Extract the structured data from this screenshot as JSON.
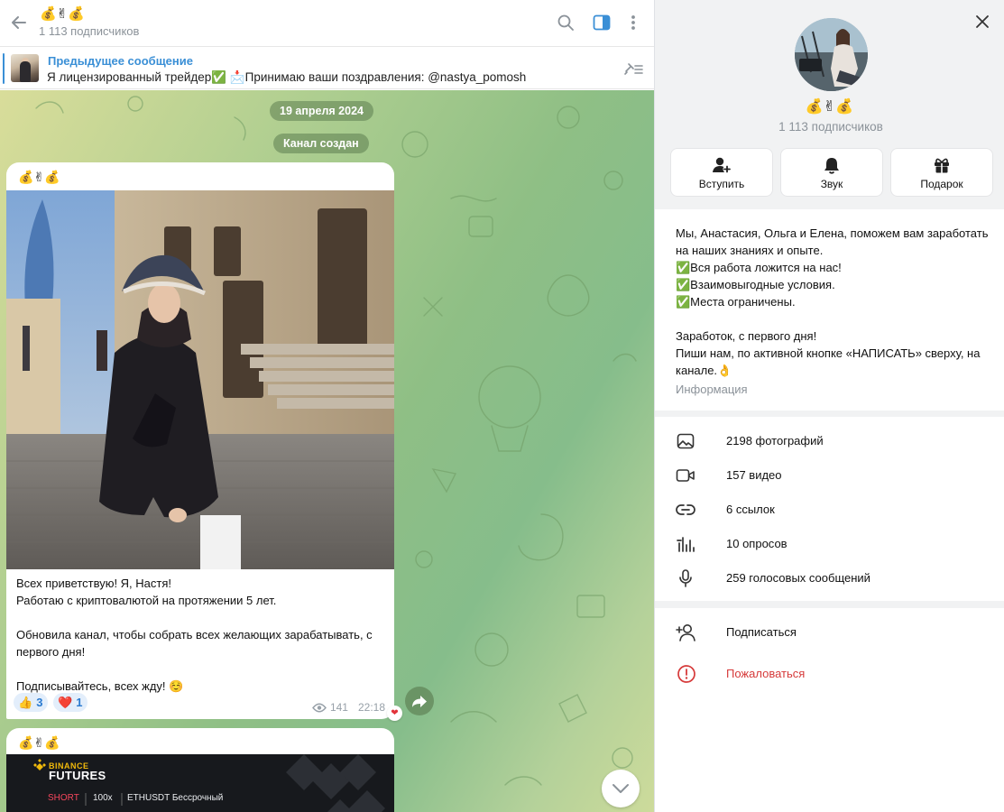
{
  "channel": {
    "title": "💰✌💰",
    "subscribers": "1 113 подписчиков"
  },
  "pinned": {
    "label": "Предыдущее сообщение",
    "text": "Я лицензированный трейдер✅  📩Принимаю ваши поздравления: @nastya_pomosh"
  },
  "chat": {
    "date_pill": "19 апреля 2024",
    "service_pill": "Канал создан",
    "messages": [
      {
        "author": "💰✌💰",
        "lines": [
          "Всех приветствую! Я, Настя!",
          "Работаю с криптовалютой на протяжении 5 лет.",
          "",
          "Обновила канал, чтобы собрать всех желающих зарабатывать, с первого дня!",
          "",
          "Подписывайтесь, всех жду! ☺️"
        ],
        "reactions": [
          {
            "emoji": "👍",
            "count": "3"
          },
          {
            "emoji": "❤️",
            "count": "1"
          }
        ],
        "views": "141",
        "time": "22:18"
      },
      {
        "author": "💰✌💰",
        "card": {
          "brand_top": "BINANCE",
          "brand_main": "FUTURES",
          "side": "SHORT",
          "leverage": "100x",
          "pair": "ETHUSDT Бессрочный"
        }
      }
    ]
  },
  "info": {
    "title": "💰✌💰",
    "subscribers": "1 113 подписчиков",
    "buttons": [
      {
        "label": "Вступить",
        "icon": "user-plus-icon"
      },
      {
        "label": "Звук",
        "icon": "bell-icon"
      },
      {
        "label": "Подарок",
        "icon": "gift-icon"
      }
    ],
    "description": [
      "Мы, Анастасия, Ольга и Елена, поможем вам заработать на наших знаниях и опыте.",
      "✅Вся работа ложится на нас!",
      "✅Взаимовыгодные условия.",
      "✅Места ограничены.",
      "",
      "Заработок, с первого дня!",
      "Пиши нам, по активной кнопке «НАПИСАТЬ» сверху, на канале.👌"
    ],
    "description_label": "Информация",
    "media": [
      {
        "label": "2198 фотографий",
        "icon": "photo-icon"
      },
      {
        "label": "157 видео",
        "icon": "video-icon"
      },
      {
        "label": "6 ссылок",
        "icon": "link-icon"
      },
      {
        "label": "10 опросов",
        "icon": "poll-icon"
      },
      {
        "label": "259 голосовых сообщений",
        "icon": "microphone-icon"
      }
    ],
    "actions": [
      {
        "label": "Подписаться",
        "icon": "add-user-icon",
        "color": "#111111"
      },
      {
        "label": "Пожаловаться",
        "icon": "report-icon",
        "color": "#d63a3a"
      }
    ]
  },
  "colors": {
    "accent": "#3a8fd6",
    "danger": "#d63a3a",
    "reaction_bg": "#e3eefb"
  }
}
